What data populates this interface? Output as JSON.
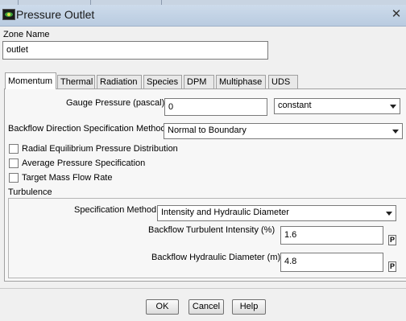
{
  "window": {
    "title": "Pressure Outlet",
    "close_glyph": "✕",
    "icon": "ansys-fluent-icon"
  },
  "zone": {
    "label": "Zone Name",
    "value": "outlet"
  },
  "tabs": [
    {
      "label": "Momentum",
      "active": true
    },
    {
      "label": "Thermal"
    },
    {
      "label": "Radiation"
    },
    {
      "label": "Species"
    },
    {
      "label": "DPM"
    },
    {
      "label": "Multiphase"
    },
    {
      "label": "UDS"
    }
  ],
  "momentum": {
    "gauge_pressure": {
      "label": "Gauge Pressure (pascal)",
      "value": "0",
      "method": "constant"
    },
    "backflow_direction": {
      "label": "Backflow Direction Specification Method",
      "value": "Normal to Boundary"
    },
    "checkboxes": [
      {
        "label": "Radial Equilibrium Pressure Distribution",
        "checked": false
      },
      {
        "label": "Average Pressure Specification",
        "checked": false
      },
      {
        "label": "Target Mass Flow Rate",
        "checked": false
      }
    ],
    "turbulence": {
      "title": "Turbulence",
      "spec_method": {
        "label": "Specification Method",
        "value": "Intensity and Hydraulic Diameter"
      },
      "intensity": {
        "label": "Backflow Turbulent Intensity (%)",
        "value": "1.6",
        "param_glyph": "P"
      },
      "diameter": {
        "label": "Backflow Hydraulic Diameter (m)",
        "value": "4.8",
        "param_glyph": "P"
      }
    }
  },
  "buttons": {
    "ok": "OK",
    "cancel": "Cancel",
    "help": "Help"
  }
}
